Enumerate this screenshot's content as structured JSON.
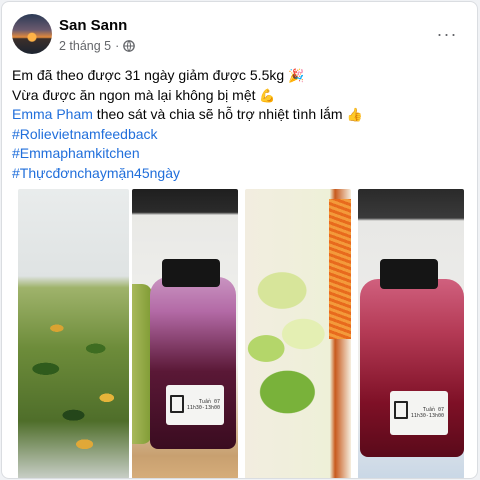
{
  "post": {
    "author": "San Sann",
    "date": "2 tháng 5",
    "separator": "·",
    "privacy_icon": "globe-icon",
    "more_icon": "more-options-icon",
    "more_label": "···"
  },
  "content": {
    "line1_text": "Em đã theo được 31 ngày giảm được 5.5kg",
    "line1_emoji": "🎉",
    "line2_text": "Vừa được ăn ngon mà lại không bị mệt",
    "line2_emoji": "💪",
    "line3_mention": "Emma Pham",
    "line3_text": " theo sát và chia sẽ hỗ trợ nhiệt tình lắm",
    "line3_emoji": "👍",
    "hashtags": [
      "#Rolievietnamfeedback",
      "#Emmaphamkitchen",
      "#Thựcđơnchaymặn45ngày"
    ]
  },
  "photos": [
    {
      "label": "",
      "subject": "greens-soup"
    },
    {
      "label_line1": "Tuần 07",
      "label_line2": "11h30-13h00",
      "subject": "purple-juice-bottle"
    },
    {
      "label": "",
      "subject": "lettuce-salad"
    },
    {
      "label_line1": "Tuần 07",
      "label_line2": "11h30-13h00",
      "subject": "red-juice-bottle"
    }
  ],
  "colors": {
    "link": "#216fdb",
    "text": "#050505",
    "meta": "#65676b",
    "background": "#f0f2f5"
  }
}
